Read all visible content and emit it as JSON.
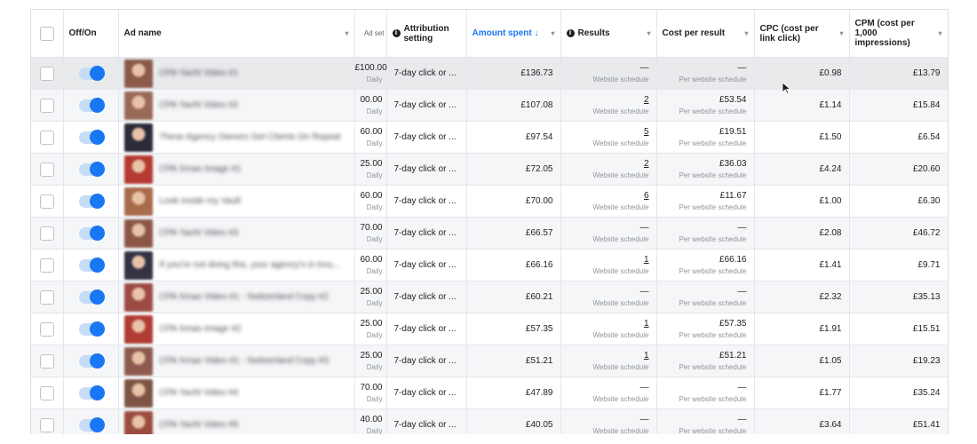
{
  "headers": {
    "offon": "Off/On",
    "ad_name": "Ad name",
    "ad_set": "Ad set",
    "attribution": "Attribution setting",
    "amount_spent": "Amount spent ↓",
    "results": "Results",
    "cost_per_result": "Cost per result",
    "cpc": "CPC (cost per link click)",
    "cpm": "CPM (cost per 1,000 impressions)"
  },
  "rows": [
    {
      "ad_name": "CPA Yacht Video #1",
      "budget": "£100.00",
      "budget_period": "Daily",
      "attribution": "7-day click or ...",
      "amount_spent": "£136.73",
      "results": "—",
      "results_type": "Website schedule",
      "cost_per_result": "—",
      "cpr_type": "Per website schedule",
      "cpc": "£0.98",
      "cpm": "£13.79",
      "hovered": true,
      "thumb": "#8a5a4a"
    },
    {
      "ad_name": "CPA Yacht Video #2",
      "budget": "00.00",
      "budget_period": "Daily",
      "attribution": "7-day click or ...",
      "amount_spent": "£107.08",
      "results": "2",
      "results_type": "Website schedule",
      "cost_per_result": "£53.54",
      "cpr_type": "Per website schedule",
      "cpc": "£1.14",
      "cpm": "£15.84",
      "thumb": "#9a6a58"
    },
    {
      "ad_name": "These Agency Owners Get Clients On Repeat",
      "budget": "60.00",
      "budget_period": "Daily",
      "attribution": "7-day click or ...",
      "amount_spent": "£97.54",
      "results": "5",
      "results_type": "Website schedule",
      "cost_per_result": "£19.51",
      "cpr_type": "Per website schedule",
      "cpc": "£1.50",
      "cpm": "£6.54",
      "thumb": "#2b2b3a"
    },
    {
      "ad_name": "CPA Xmas Image #1",
      "budget": "25.00",
      "budget_period": "Daily",
      "attribution": "7-day click or ...",
      "amount_spent": "£72.05",
      "results": "2",
      "results_type": "Website schedule",
      "cost_per_result": "£36.03",
      "cpr_type": "Per website schedule",
      "cpc": "£4.24",
      "cpm": "£20.60",
      "thumb": "#b43a32"
    },
    {
      "ad_name": "Look inside my Vault",
      "budget": "60.00",
      "budget_period": "Daily",
      "attribution": "7-day click or ...",
      "amount_spent": "£70.00",
      "results": "6",
      "results_type": "Website schedule",
      "cost_per_result": "£11.67",
      "cpr_type": "Per website schedule",
      "cpc": "£1.00",
      "cpm": "£6.30",
      "thumb": "#a86b4c"
    },
    {
      "ad_name": "CPA Yacht Video #3",
      "budget": "70.00",
      "budget_period": "Daily",
      "attribution": "7-day click or ...",
      "amount_spent": "£66.57",
      "results": "—",
      "results_type": "Website schedule",
      "cost_per_result": "—",
      "cpr_type": "Per website schedule",
      "cpc": "£2.08",
      "cpm": "£46.72",
      "thumb": "#8c5646"
    },
    {
      "ad_name": "If you're not doing this, your agency's in trou...",
      "budget": "60.00",
      "budget_period": "Daily",
      "attribution": "7-day click or ...",
      "amount_spent": "£66.16",
      "results": "1",
      "results_type": "Website schedule",
      "cost_per_result": "£66.16",
      "cpr_type": "Per website schedule",
      "cpc": "£1.41",
      "cpm": "£9.71",
      "thumb": "#333344"
    },
    {
      "ad_name": "CPA Xmas Video #1 - Switzerland Copy #2",
      "budget": "25.00",
      "budget_period": "Daily",
      "attribution": "7-day click or ...",
      "amount_spent": "£60.21",
      "results": "—",
      "results_type": "Website schedule",
      "cost_per_result": "—",
      "cpr_type": "Per website schedule",
      "cpc": "£2.32",
      "cpm": "£35.13",
      "thumb": "#9c4a44"
    },
    {
      "ad_name": "CPA Xmas Image #2",
      "budget": "25.00",
      "budget_period": "Daily",
      "attribution": "7-day click or ...",
      "amount_spent": "£57.35",
      "results": "1",
      "results_type": "Website schedule",
      "cost_per_result": "£57.35",
      "cpr_type": "Per website schedule",
      "cpc": "£1.91",
      "cpm": "£15.51",
      "thumb": "#b03c34"
    },
    {
      "ad_name": "CPA Xmas Video #1 - Switzerland Copy #3",
      "budget": "25.00",
      "budget_period": "Daily",
      "attribution": "7-day click or ...",
      "amount_spent": "£51.21",
      "results": "1",
      "results_type": "Website schedule",
      "cost_per_result": "£51.21",
      "cpr_type": "Per website schedule",
      "cpc": "£1.05",
      "cpm": "£19.23",
      "thumb": "#8e5a50"
    },
    {
      "ad_name": "CPA Yacht Video #4",
      "budget": "70.00",
      "budget_period": "Daily",
      "attribution": "7-day click or ...",
      "amount_spent": "£47.89",
      "results": "—",
      "results_type": "Website schedule",
      "cost_per_result": "—",
      "cpr_type": "Per website schedule",
      "cpc": "£1.77",
      "cpm": "£35.24",
      "thumb": "#7e5444"
    },
    {
      "ad_name": "CPA Yacht Video #5",
      "budget": "40.00",
      "budget_period": "Daily",
      "attribution": "7-day click or ...",
      "amount_spent": "£40.05",
      "results": "—",
      "results_type": "Website schedule",
      "cost_per_result": "—",
      "cpr_type": "Per website schedule",
      "cpc": "£3.64",
      "cpm": "£51.41",
      "thumb": "#9a4c40"
    }
  ],
  "colors": {
    "accent": "#1877f2",
    "toggle_track": "#c8dcf8",
    "border": "#e4e6eb"
  },
  "icons": {
    "sort": "chevron-down-icon",
    "info": "info-icon",
    "cursor": "mouse-pointer-icon"
  }
}
